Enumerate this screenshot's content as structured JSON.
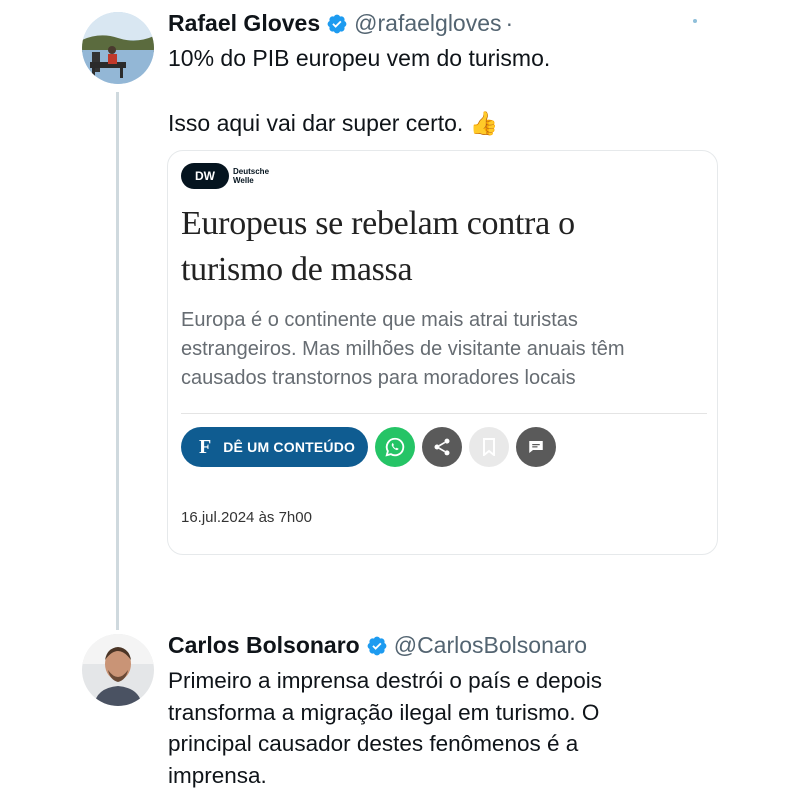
{
  "tweet1": {
    "display_name": "Rafael Gloves",
    "handle": "@rafaelgloves",
    "dot": "·",
    "text_line1": "10% do PIB europeu vem do turismo.",
    "text_line2": "Isso aqui vai dar super certo. 👍"
  },
  "card": {
    "logo_text_1": "Deutsche",
    "logo_text_2": "Welle",
    "logo_badge": "DW",
    "headline_1": "Europeus se rebelam contra o",
    "headline_2": "turismo de massa",
    "summary_1": "Europa é o continente que mais atrai turistas",
    "summary_2": "estrangeiros. Mas milhões de visitante anuais têm",
    "summary_3": "causados transtornos para moradores locais",
    "donate_icon": "F",
    "donate_label": "DÊ UM CONTEÚDO",
    "date": "16.jul.2024 às 7h00"
  },
  "tweet2": {
    "display_name": "Carlos Bolsonaro",
    "handle": "@CarlosBolsonaro",
    "text_line1": "Primeiro a imprensa destrói o país e depois",
    "text_line2": "transforma a migração ilegal em turismo. O",
    "text_line3": "principal causador destes fenômenos é a",
    "text_line4": "imprensa."
  },
  "colors": {
    "verified_blue": "#1d9bf0",
    "handle_gray": "#536471",
    "dw_blue": "#0f5c91",
    "whatsapp_green": "#25c466"
  },
  "icons": [
    "verified-badge-icon",
    "whatsapp-icon",
    "share-icon",
    "bookmark-icon",
    "comment-icon"
  ]
}
